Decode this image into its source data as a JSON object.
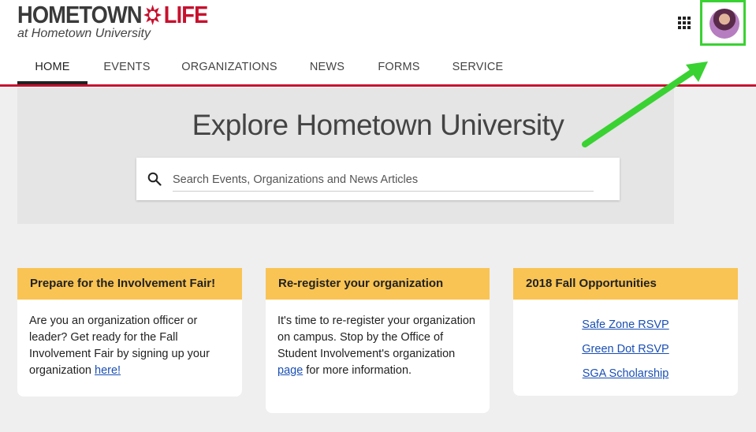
{
  "brand": {
    "name_part1": "HOMETOWN",
    "name_part2": "LIFE",
    "subtitle": "at Hometown University",
    "logo_color": "#c8102e"
  },
  "header": {
    "apps_icon": "grid-icon",
    "avatar_icon": "user-avatar"
  },
  "nav": {
    "items": [
      {
        "label": "HOME",
        "active": true
      },
      {
        "label": "EVENTS"
      },
      {
        "label": "ORGANIZATIONS"
      },
      {
        "label": "NEWS"
      },
      {
        "label": "FORMS"
      },
      {
        "label": "SERVICE"
      }
    ],
    "accent": "#c8102e"
  },
  "hero": {
    "title": "Explore Hometown University",
    "search_placeholder": "Search Events, Organizations and News Articles"
  },
  "cards": [
    {
      "title": "Prepare for the Involvement Fair!",
      "text": "Are you an organization officer or leader? Get ready for the Fall Involvement Fair by signing up your organization ",
      "link": "here!"
    },
    {
      "title": "Re-register your organization",
      "text_before": "It's time to re-register your organization on campus. Stop by the Office of Student Involvement's organization ",
      "link": "page",
      "text_after": " for more information."
    },
    {
      "title": "2018 Fall Opportunities",
      "links": [
        "Safe Zone RSVP",
        "Green Dot RSVP",
        "SGA Scholarship"
      ]
    }
  ],
  "annotation": {
    "arrow_color": "#39d232",
    "highlight_color": "#39d232"
  }
}
